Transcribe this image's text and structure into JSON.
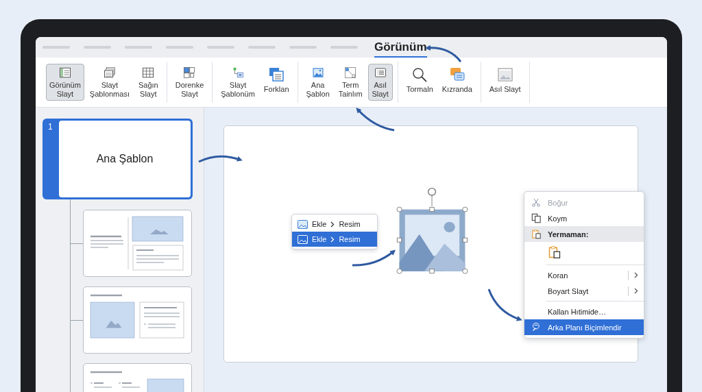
{
  "tabs": [
    {
      "kind": "placeholder",
      "selected": false
    },
    {
      "kind": "placeholder",
      "selected": false
    },
    {
      "kind": "placeholder",
      "selected": false
    },
    {
      "kind": "placeholder",
      "selected": false
    },
    {
      "kind": "placeholder",
      "selected": false
    },
    {
      "kind": "placeholder",
      "selected": false
    },
    {
      "kind": "placeholder",
      "selected": false
    },
    {
      "kind": "placeholder",
      "selected": false
    },
    {
      "kind": "label",
      "label": "Görünüm",
      "selected": true
    }
  ],
  "ribbon": {
    "groups": [
      {
        "buttons": [
          {
            "label": "Görünüm\nSlayt",
            "kind": "sorter",
            "selected": true
          },
          {
            "label": "Slayt\nŞablonması",
            "kind": "stack",
            "selected": false
          },
          {
            "label": "Sağın\nSlayt",
            "kind": "grid",
            "selected": false
          }
        ]
      },
      {
        "buttons": [
          {
            "label": "Dorenke\nSlayt",
            "kind": "blocks",
            "selected": false
          }
        ]
      },
      {
        "buttons": [
          {
            "label": "Slayt\nŞablonüm",
            "kind": "connector",
            "selected": false
          },
          {
            "label": "Forklan",
            "kind": "cards",
            "selected": false
          }
        ]
      },
      {
        "buttons": [
          {
            "label": "Ana\nŞablon",
            "kind": "image",
            "selected": false
          },
          {
            "label": "Term\nTainlım",
            "kind": "diagonal",
            "selected": false
          },
          {
            "label": "Asıl\nSlayt",
            "kind": "list",
            "selected": true
          }
        ]
      },
      {
        "buttons": [
          {
            "label": "Tormaln",
            "kind": "search",
            "selected": false
          },
          {
            "label": "Kızranda",
            "kind": "chat",
            "selected": false
          }
        ]
      },
      {
        "buttons": [
          {
            "label": "Asıl Slayt",
            "kind": "picture",
            "selected": false
          }
        ]
      }
    ]
  },
  "slides_panel": {
    "master": {
      "number": "1",
      "title": "Ana Şablon",
      "selected": true
    },
    "layouts": [
      {
        "kind": "text-image"
      },
      {
        "kind": "image-text"
      },
      {
        "kind": "bullets-image"
      }
    ]
  },
  "insert_menu": [
    {
      "verb": "Ekle",
      "object": "Resim",
      "selected": false
    },
    {
      "verb": "Ekle",
      "object": "Resim",
      "selected": true
    }
  ],
  "context_menu": [
    {
      "kind": "cut",
      "label": "Boğur",
      "disabled": true,
      "selected": false
    },
    {
      "kind": "copy",
      "label": "Koym",
      "disabled": false,
      "selected": false
    },
    {
      "kind": "paste-header",
      "label": "Yermaman:"
    },
    {
      "kind": "paste-option"
    },
    {
      "kind": "separator"
    },
    {
      "kind": "submenu",
      "label": "Koran"
    },
    {
      "kind": "submenu",
      "label": "Boyart Slayt"
    },
    {
      "kind": "separator"
    },
    {
      "kind": "plain",
      "label": "Kallan Hıtimide…",
      "disabled": false,
      "selected": false
    },
    {
      "kind": "format-background",
      "label": "Arka Planı Biçimlendir",
      "disabled": false,
      "selected": true
    }
  ]
}
